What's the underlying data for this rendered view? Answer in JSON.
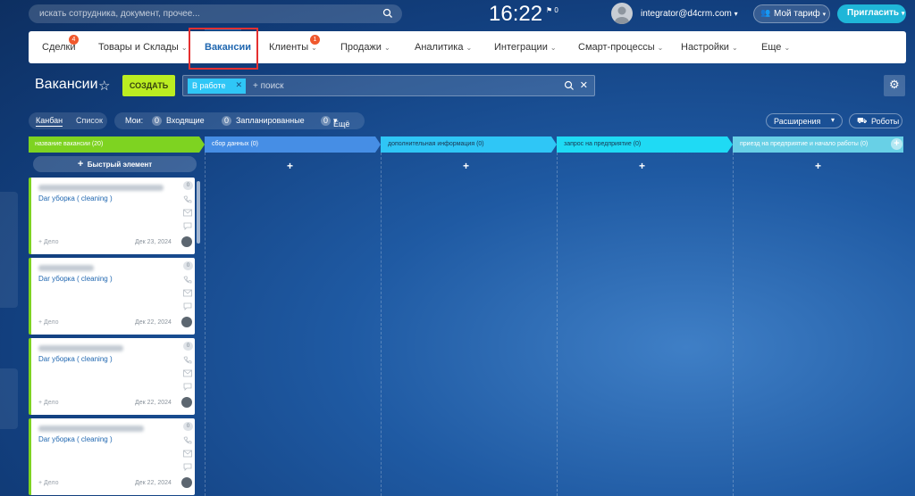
{
  "topbar": {
    "search_placeholder": "искать сотрудника, документ, прочее...",
    "clock": "16:22",
    "flag_count": "0",
    "user": "integrator@d4crm.com",
    "tariff": "Мой тариф",
    "invite": "Пригласить"
  },
  "nav": {
    "items": [
      {
        "label": "Сделки",
        "badge": "4"
      },
      {
        "label": "Товары и Склады"
      },
      {
        "label": "Вакансии"
      },
      {
        "label": "Клиенты",
        "badge": "1"
      },
      {
        "label": "Продажи"
      },
      {
        "label": "Аналитика"
      },
      {
        "label": "Интеграции"
      },
      {
        "label": "Смарт-процессы"
      },
      {
        "label": "Настройки"
      },
      {
        "label": "Еще"
      }
    ]
  },
  "page": {
    "title": "Вакансии",
    "create_label": "СОЗДАТЬ",
    "filter_chip": "В работе",
    "filter_placeholder": "+ поиск"
  },
  "views": {
    "kanban": "Канбан",
    "list": "Список",
    "mine_label": "Мои:",
    "incoming_count": "0",
    "incoming": "Входящие",
    "planned_count": "0",
    "planned": "Запланированные",
    "more_count": "0",
    "more": "Ещё",
    "extensions": "Расширения",
    "robots": "Роботы"
  },
  "columns": [
    {
      "title": "название вакансии",
      "count": "(20)",
      "color": "#7ed321"
    },
    {
      "title": "сбор данных",
      "count": "(0)",
      "color": "#468ee5"
    },
    {
      "title": "дополнительная информация",
      "count": "(0)",
      "color": "#2fc6f6"
    },
    {
      "title": "запрос на предприятие",
      "count": "(0)",
      "color": "#2fe0f6"
    },
    {
      "title": "приезд на предприятие и начало работы",
      "count": "(0)",
      "color": "#68d0e6"
    }
  ],
  "quick_add": "Быстрый элемент",
  "cards": [
    {
      "deal": "Dar уборка ( cleaning )",
      "add": "+ Дело",
      "date": "Дек 23, 2024",
      "badge": "0"
    },
    {
      "deal": "Dar уборка ( cleaning )",
      "add": "+ Дело",
      "date": "Дек 22, 2024",
      "badge": "0"
    },
    {
      "deal": "Dar уборка ( cleaning )",
      "add": "+ Дело",
      "date": "Дек 22, 2024",
      "badge": "0"
    },
    {
      "deal": "Dar уборка ( cleaning )",
      "add": "+ Дело",
      "date": "Дек 22, 2024",
      "badge": "0"
    }
  ],
  "column_plus": "+"
}
